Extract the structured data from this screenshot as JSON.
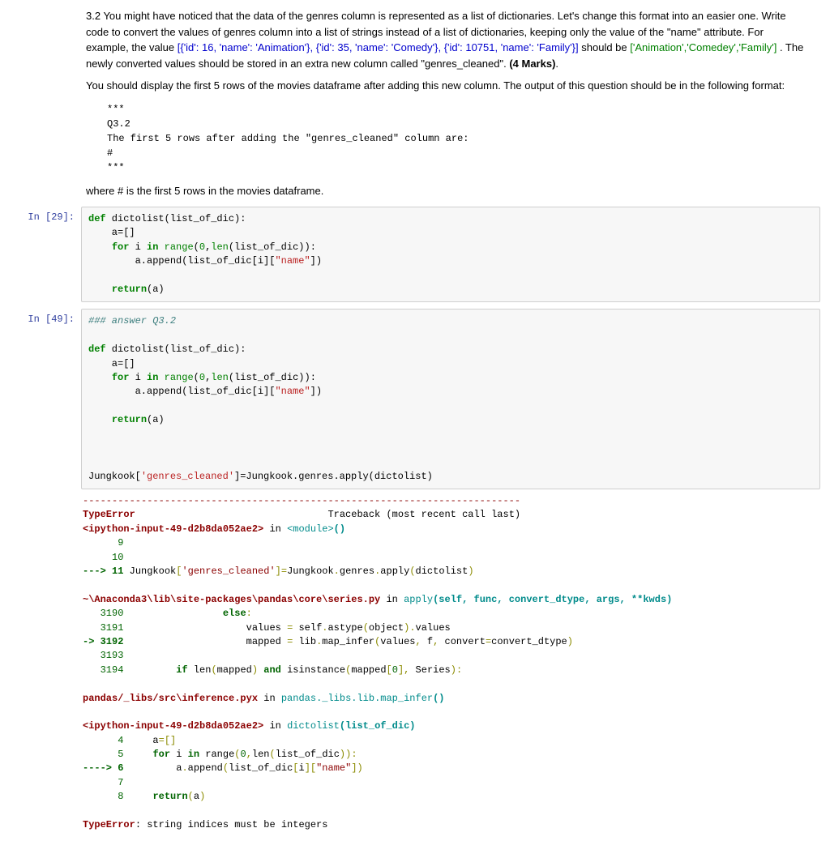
{
  "question": {
    "intro1": "3.2 You might have noticed that the data of the genres column is represented as a list of dictionaries. Let's change this format into an easier one. Write code to convert the values of genres column into a list of strings instead of a list of dictionaries, keeping only the value of the \"name\" attribute. For example, the value ",
    "example_in": "[{'id': 16, 'name': 'Animation'}, {'id': 35, 'name': 'Comedy'}, {'id': 10751, 'name': 'Family'}]",
    "mid": " should be ",
    "example_out": "['Animation','Comedey','Family']",
    "intro2": ". The newly converted values should be stored in an extra new column called \"genres_cleaned\". ",
    "marks": "(4 Marks)",
    "dot": ".",
    "format_hint": "You should display the first 5 rows of the movies dataframe after adding this new column. The output of this question should be in the following format:",
    "expected_output": "***\nQ3.2\nThe first 5 rows after adding the \"genres_cleaned\" column are:\n#\n***",
    "where_hash": "where # is the first 5 rows in the movies dataframe."
  },
  "cells": {
    "c29": {
      "prompt": "In [29]:",
      "lines": {
        "l0a": "def",
        "l0b": " dictolist(list_of_dic):",
        "l1": "    a=[]",
        "l2a": "    ",
        "l2b": "for",
        "l2c": " i ",
        "l2d": "in",
        "l2e": " ",
        "l2f": "range",
        "l2g": "(",
        "l2h": "0",
        "l2i": ",",
        "l2j": "len",
        "l2k": "(list_of_dic)):",
        "l3a": "        a.append(list_of_dic[i][",
        "l3b": "\"name\"",
        "l3c": "])",
        "l4": "        ",
        "l5a": "    ",
        "l5b": "return",
        "l5c": "(a)"
      }
    },
    "c49": {
      "prompt": "In [49]:",
      "lines": {
        "cmt": "### answer Q3.2",
        "blank0": "",
        "l0a": "def",
        "l0b": " dictolist(list_of_dic):",
        "l1": "    a=[]",
        "l2a": "    ",
        "l2b": "for",
        "l2c": " i ",
        "l2d": "in",
        "l2e": " ",
        "l2f": "range",
        "l2g": "(",
        "l2h": "0",
        "l2i": ",",
        "l2j": "len",
        "l2k": "(list_of_dic)):",
        "l3a": "        a.append(list_of_dic[i][",
        "l3b": "\"name\"",
        "l3c": "])",
        "l4": "        ",
        "l5a": "    ",
        "l5b": "return",
        "l5c": "(a)",
        "blank1": "",
        "blank2": "",
        "blank3": "",
        "call_a": "Jungkook[",
        "call_b": "'genres_cleaned'",
        "call_c": "]=Jungkook.genres.apply(dictolist)"
      }
    }
  },
  "traceback": {
    "sep": "---------------------------------------------------------------------------",
    "header_err": "TypeError",
    "header_right": "                                 Traceback (most recent call last)",
    "f1_file": "<ipython-input-49-d2b8da052ae2>",
    "f1_in": " in ",
    "f1_mod": "<module>",
    "f1_paren": "()",
    "f1_l9": "      9",
    "f1_l10": "     10",
    "f1_l11_arrow": "---> 11",
    "f1_l11_a": " Jungkook",
    "f1_l11_b": "[",
    "f1_l11_c": "'genres_cleaned'",
    "f1_l11_d": "]=",
    "f1_l11_e": "Jungkook",
    "f1_l11_f": ".",
    "f1_l11_g": "genres",
    "f1_l11_h": ".",
    "f1_l11_i": "apply",
    "f1_l11_j": "(",
    "f1_l11_k": "dictolist",
    "f1_l11_l": ")",
    "blank1": "",
    "f2_file": "~\\Anaconda3\\lib\\site-packages\\pandas\\core\\series.py",
    "f2_in": " in ",
    "f2_func": "apply",
    "f2_sig_a": "(self, func, convert_dtype, args, **kwds)",
    "f2_l3190": "   3190",
    "f2_l3190_b": "                 ",
    "f2_l3190_kw": "else",
    "f2_l3190_c": ":",
    "f2_l3191": "   3191",
    "f2_l3191_b": "                     values ",
    "f2_l3191_eq": "=",
    "f2_l3191_c": " self",
    "f2_l3191_d": ".",
    "f2_l3191_e": "astype",
    "f2_l3191_f": "(",
    "f2_l3191_g": "object",
    "f2_l3191_h": ")",
    "f2_l3191_i": ".",
    "f2_l3191_j": "values",
    "f2_l3192_arrow": "-> 3192",
    "f2_l3192_b": "                     mapped ",
    "f2_l3192_eq": "=",
    "f2_l3192_c": " lib",
    "f2_l3192_d": ".",
    "f2_l3192_e": "map_infer",
    "f2_l3192_f": "(",
    "f2_l3192_g": "values",
    "f2_l3192_h": ",",
    "f2_l3192_i": " f",
    "f2_l3192_j": ",",
    "f2_l3192_k": " convert",
    "f2_l3192_l": "=",
    "f2_l3192_m": "convert_dtype",
    "f2_l3192_n": ")",
    "f2_l3193": "   3193",
    "f2_l3194": "   3194",
    "f2_l3194_b": "         ",
    "f2_l3194_kw": "if",
    "f2_l3194_c": " len",
    "f2_l3194_d": "(",
    "f2_l3194_e": "mapped",
    "f2_l3194_f": ")",
    "f2_l3194_g": " ",
    "f2_l3194_kw2": "and",
    "f2_l3194_h": " isinstance",
    "f2_l3194_i": "(",
    "f2_l3194_j": "mapped",
    "f2_l3194_k": "[",
    "f2_l3194_l": "0",
    "f2_l3194_m": "]",
    "f2_l3194_n": ",",
    "f2_l3194_o": " Series",
    "f2_l3194_p": ")",
    "f2_l3194_q": ":",
    "blank2": "",
    "f3_file": "pandas/_libs/src\\inference.pyx",
    "f3_in": " in ",
    "f3_func": "pandas._libs.lib.map_infer",
    "f3_paren": "()",
    "blank3": "",
    "f4_file": "<ipython-input-49-d2b8da052ae2>",
    "f4_in": " in ",
    "f4_func": "dictolist",
    "f4_sig": "(list_of_dic)",
    "f4_l4": "      4",
    "f4_l4_b": "     a",
    "f4_l4_c": "=[]",
    "f4_l5": "      5",
    "f4_l5_b": "     ",
    "f4_l5_kw": "for",
    "f4_l5_c": " i ",
    "f4_l5_kw2": "in",
    "f4_l5_d": " range",
    "f4_l5_e": "(",
    "f4_l5_f": "0",
    "f4_l5_g": ",",
    "f4_l5_h": "len",
    "f4_l5_i": "(",
    "f4_l5_j": "list_of_dic",
    "f4_l5_k": ")",
    "f4_l5_l": ")",
    "f4_l5_m": ":",
    "f4_l6_arrow": "----> 6",
    "f4_l6_b": "         a",
    "f4_l6_c": ".",
    "f4_l6_d": "append",
    "f4_l6_e": "(",
    "f4_l6_f": "list_of_dic",
    "f4_l6_g": "[",
    "f4_l6_h": "i",
    "f4_l6_i": "]",
    "f4_l6_j": "[",
    "f4_l6_k": "\"name\"",
    "f4_l6_l": "]",
    "f4_l6_m": ")",
    "f4_l7": "      7",
    "f4_l8": "      8",
    "f4_l8_b": "     ",
    "f4_l8_kw": "return",
    "f4_l8_c": "(",
    "f4_l8_d": "a",
    "f4_l8_e": ")",
    "blank4": "",
    "final_err": "TypeError",
    "final_msg": ": string indices must be integers"
  }
}
